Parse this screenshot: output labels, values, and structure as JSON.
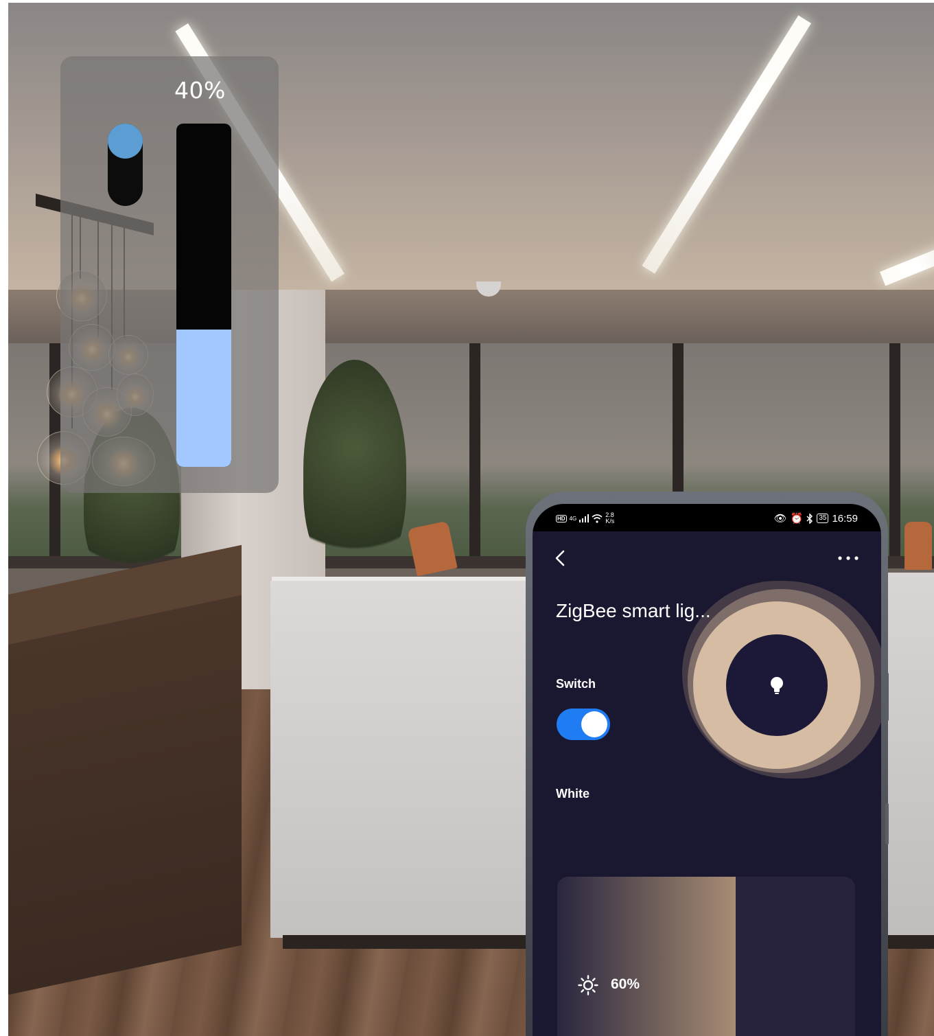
{
  "overlay_dimmer": {
    "value_label": "40%",
    "level": 0.4,
    "knob_color": "#5c9ed3",
    "fill_color": "#a3c8ff"
  },
  "phone": {
    "status_bar": {
      "hd": "HD",
      "signal": "4G",
      "speed_top": "2.8",
      "speed_unit": "K/s",
      "battery": "35",
      "time": "16:59"
    },
    "app": {
      "title": "ZigBee smart lig...",
      "switch_label": "Switch",
      "switch_on": true,
      "accent_color": "#1f7cf2",
      "mode_label": "White",
      "brightness_value": "60%",
      "brightness_level": 0.6,
      "icons": [
        "back-icon",
        "more-icon",
        "bulb-icon",
        "sun-icon"
      ]
    }
  }
}
